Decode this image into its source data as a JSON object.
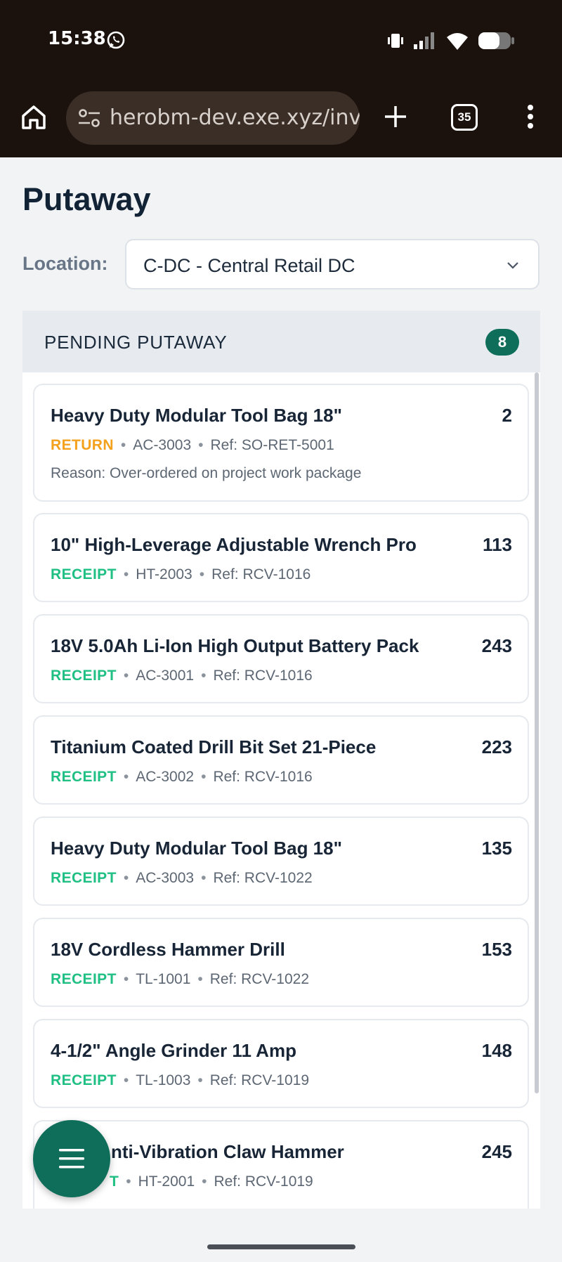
{
  "status_bar": {
    "time": "15:38"
  },
  "browser": {
    "url": "herobm-dev.exe.xyz/inve",
    "tab_count": "35"
  },
  "page": {
    "title": "Putaway"
  },
  "location": {
    "label": "Location:",
    "selected": "C-DC - Central Retail DC"
  },
  "panel": {
    "title": "PENDING PUTAWAY",
    "count": "8"
  },
  "items": [
    {
      "name": "Heavy Duty Modular Tool Bag 18\"",
      "qty": "2",
      "type": "RETURN",
      "sku": "AC-3003",
      "ref": "Ref: SO-RET-5001",
      "reason": "Reason: Over-ordered on project work package"
    },
    {
      "name": "10\" High-Leverage Adjustable Wrench Pro",
      "qty": "113",
      "type": "RECEIPT",
      "sku": "HT-2003",
      "ref": "Ref: RCV-1016"
    },
    {
      "name": "18V 5.0Ah Li-Ion High Output Battery Pack",
      "qty": "243",
      "type": "RECEIPT",
      "sku": "AC-3001",
      "ref": "Ref: RCV-1016"
    },
    {
      "name": "Titanium Coated Drill Bit Set 21-Piece",
      "qty": "223",
      "type": "RECEIPT",
      "sku": "AC-3002",
      "ref": "Ref: RCV-1016"
    },
    {
      "name": "Heavy Duty Modular Tool Bag 18\"",
      "qty": "135",
      "type": "RECEIPT",
      "sku": "AC-3003",
      "ref": "Ref: RCV-1022"
    },
    {
      "name": "18V Cordless Hammer Drill",
      "qty": "153",
      "type": "RECEIPT",
      "sku": "TL-1001",
      "ref": "Ref: RCV-1022"
    },
    {
      "name": "4-1/2\" Angle Grinder 11 Amp",
      "qty": "148",
      "type": "RECEIPT",
      "sku": "TL-1003",
      "ref": "Ref: RCV-1019"
    },
    {
      "name": "nti-Vibration Claw Hammer",
      "qty": "245",
      "type": "T",
      "sku": "HT-2001",
      "ref": "Ref: RCV-1019"
    }
  ]
}
